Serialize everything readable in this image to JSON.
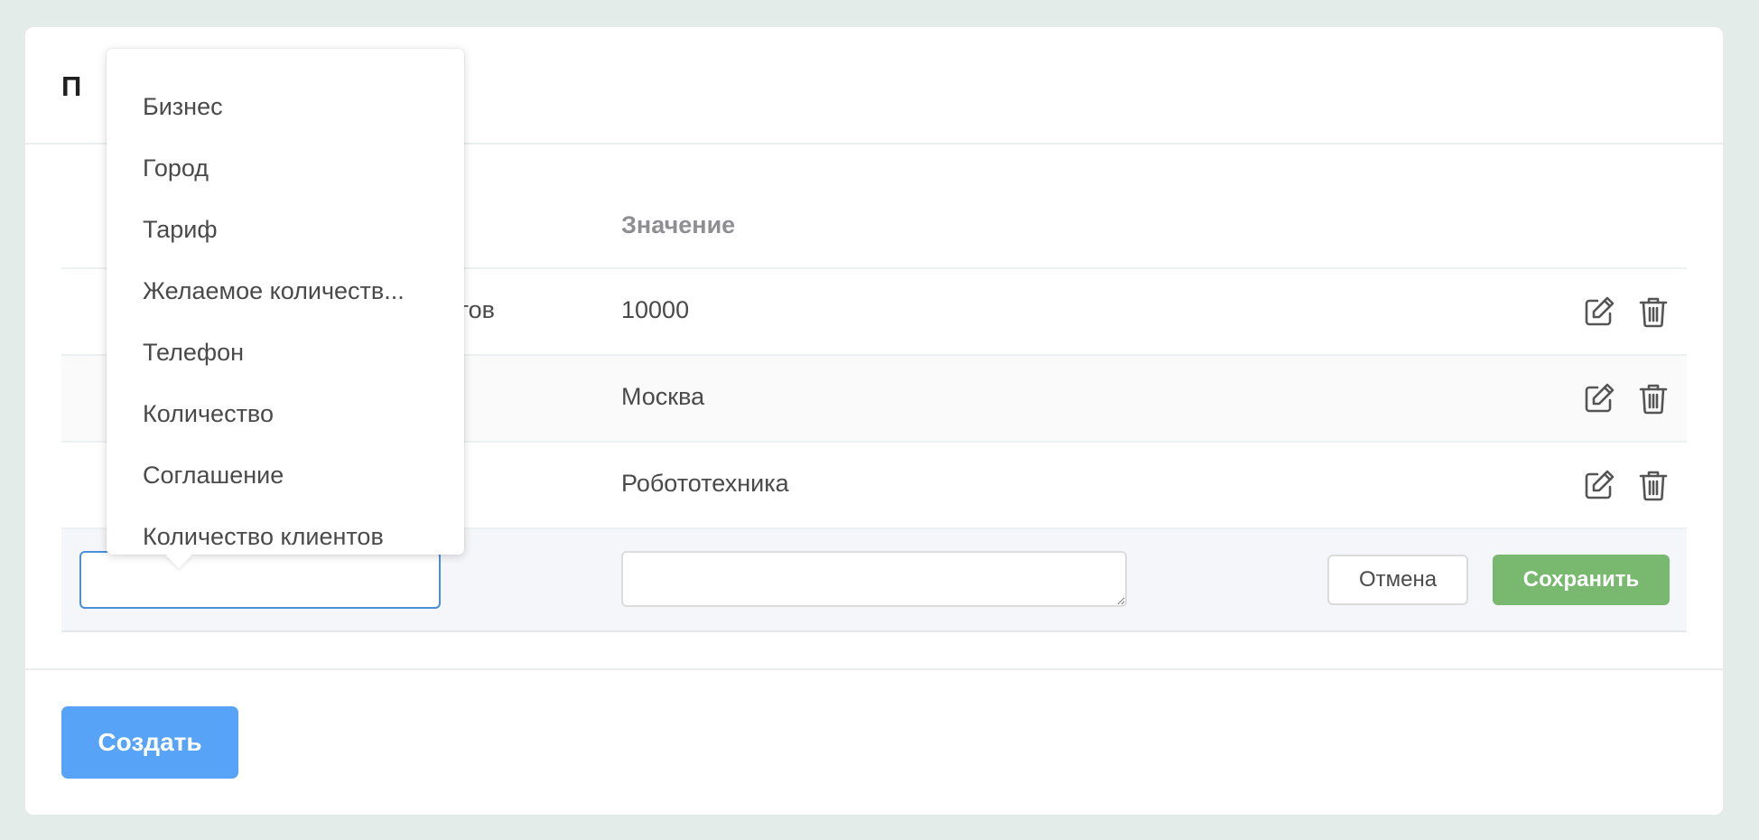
{
  "card": {
    "title": "П"
  },
  "table": {
    "headers": {
      "value": "Значение"
    },
    "rows": [
      {
        "key": "тов",
        "value": "10000"
      },
      {
        "key": "",
        "value": "Москва"
      },
      {
        "key": "",
        "value": "Робототехника"
      }
    ]
  },
  "edit_row": {
    "key_value": "",
    "value_value": "",
    "cancel_label": "Отмена",
    "save_label": "Сохранить"
  },
  "dropdown": {
    "items": [
      "Бизнес",
      "Город",
      "Тариф",
      "Желаемое количеств...",
      "Телефон",
      "Количество",
      "Соглашение",
      "Количество клиентов"
    ]
  },
  "footer": {
    "create_label": "Создать"
  },
  "icons": {
    "edit": "pencil-square-icon",
    "delete": "trash-icon"
  },
  "colors": {
    "save": "#78b86f",
    "create": "#56a3f8",
    "input_focus": "#4a8fd9"
  }
}
